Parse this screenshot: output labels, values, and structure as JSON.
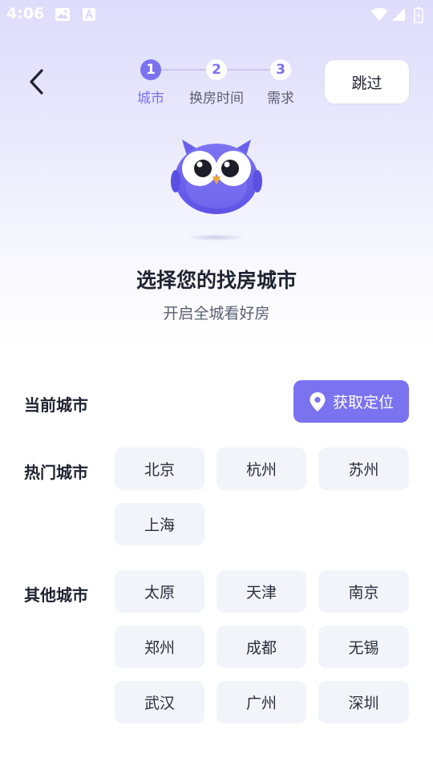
{
  "status_bar": {
    "time": "4:06"
  },
  "header": {
    "steps": [
      {
        "number": "1",
        "label": "城市"
      },
      {
        "number": "2",
        "label": "换房时间"
      },
      {
        "number": "3",
        "label": "需求"
      }
    ],
    "skip_label": "跳过"
  },
  "colors": {
    "accent": "#7b72f0",
    "chip_bg": "#f2f4fa",
    "text_primary": "#1f2330",
    "text_secondary": "#5b6072"
  },
  "hero": {
    "title": "选择您的找房城市",
    "subtitle": "开启全城看好房"
  },
  "current_city": {
    "label": "当前城市",
    "locate_button": "获取定位",
    "locate_icon": "location-pin-icon"
  },
  "hot_cities": {
    "label": "热门城市",
    "items": [
      "北京",
      "杭州",
      "苏州",
      "上海"
    ]
  },
  "other_cities": {
    "label": "其他城市",
    "items": [
      "太原",
      "天津",
      "南京",
      "郑州",
      "成都",
      "无锡",
      "武汉",
      "广州",
      "深圳"
    ]
  }
}
